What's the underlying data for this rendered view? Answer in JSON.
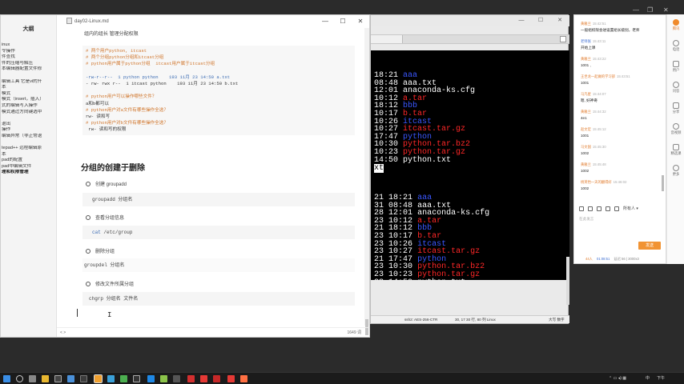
{
  "editor": {
    "title": "day02-Linux.md",
    "outline_title": "大纲",
    "outline_items": [
      "inux",
      "令操作",
      "件查找",
      "件的压缩与解压",
      "本编辑器配置文件修",
      "",
      "编辑工具 它是vi的升",
      "本",
      "模式",
      "模式（insert，插入）",
      "式的编辑写入操作",
      "模式通过方向键选中",
      "",
      "退出",
      "操作",
      "编辑异常（非正常退",
      "",
      "tepad++ 远程编辑原",
      "本",
      "pad的配置",
      "pad中编辑文件",
      "理和权限管理"
    ],
    "top_text": "组内的组长    管理分配权限",
    "code_block_1": [
      {
        "cls": "cm",
        "text": "# 两个用户python, itcast"
      },
      {
        "cls": "cm",
        "text": "# 两个分组python分组和itcast分组"
      },
      {
        "cls": "cm",
        "text": "# python用户属于python分组  itcast用户属于itcast分组"
      },
      {
        "cls": "tx",
        "text": ""
      },
      {
        "cls": "pl",
        "text": "-rw-r--r--  1 python python    193 11月 23 14:50 a.txt"
      },
      {
        "cls": "tx",
        "text": "- rw- rwx r--  1 itcast python    193 11月 23 14:50 b.txt"
      },
      {
        "cls": "tx",
        "text": ""
      },
      {
        "cls": "cm",
        "text": "# python用户可以操作哪些文件？"
      },
      {
        "cls": "tx",
        "text": "a和b都可以"
      },
      {
        "cls": "cm",
        "text": "# python用户对a文件有哪些操作全选？"
      },
      {
        "cls": "tx",
        "text": "rw- 读和写"
      },
      {
        "cls": "cm",
        "text": "# python用户对b文件有哪些操作全选？"
      },
      {
        "cls": "tx",
        "text": " rw- 读和写的权限"
      }
    ],
    "heading": "分组的创建于删除",
    "bullet_create": "创建 groupadd",
    "code_create": "groupadd 分组名",
    "bullet_view": "查看分组信息",
    "code_view_kw": "cat",
    "code_view_rest": " /etc/group",
    "bullet_delete": "删除分组",
    "code_delete": "groupdel 分组名",
    "bullet_modify": "修改文件所属分组",
    "code_modify": "chgrp 分组名 文件名",
    "status_left": "<  >",
    "word_count": "1649 词"
  },
  "terminal": {
    "upper": [
      {
        "time": "18:21",
        "name": "aaa",
        "color": "b"
      },
      {
        "time": "08:48",
        "name": "aaa.txt",
        "color": "w"
      },
      {
        "time": "12:01",
        "name": "anaconda-ks.cfg",
        "color": "w"
      },
      {
        "time": "10:12",
        "name": "a.tar",
        "color": "r"
      },
      {
        "time": "18:12",
        "name": "bbb",
        "color": "b"
      },
      {
        "time": "10:17",
        "name": "b.tar",
        "color": "r"
      },
      {
        "time": "10:26",
        "name": "itcast",
        "color": "b"
      },
      {
        "time": "10:27",
        "name": "itcast.tar.gz",
        "color": "r"
      },
      {
        "time": "17:47",
        "name": "python",
        "color": "b"
      },
      {
        "time": "10:30",
        "name": "python.tar.bz2",
        "color": "r"
      },
      {
        "time": "10:23",
        "name": "python.tar.gz",
        "color": "r"
      },
      {
        "time": "14:50",
        "name": "python.txt",
        "color": "w"
      }
    ],
    "mid_fragment": "xt",
    "lower": [
      {
        "day": "21",
        "time": "18:21",
        "name": "aaa",
        "color": "b"
      },
      {
        "day": "31",
        "time": "08:48",
        "name": "aaa.txt",
        "color": "w"
      },
      {
        "day": "28",
        "time": "12:01",
        "name": "anaconda-ks.cfg",
        "color": "w"
      },
      {
        "day": "23",
        "time": "10:12",
        "name": "a.tar",
        "color": "r"
      },
      {
        "day": "21",
        "time": "18:12",
        "name": "bbb",
        "color": "b"
      },
      {
        "day": "23",
        "time": "10:17",
        "name": "b.tar",
        "color": "r"
      },
      {
        "day": "23",
        "time": "10:26",
        "name": "itcast",
        "color": "b"
      },
      {
        "day": "23",
        "time": "10:27",
        "name": "itcast.tar.gz",
        "color": "r"
      },
      {
        "day": "21",
        "time": "17:47",
        "name": "python",
        "color": "b"
      },
      {
        "day": "23",
        "time": "10:30",
        "name": "python.tar.bz2",
        "color": "r"
      },
      {
        "day": "23",
        "time": "10:23",
        "name": "python.tar.gz",
        "color": "r"
      },
      {
        "day": "23",
        "time": "14:50",
        "name": "python.txt",
        "color": "w"
      }
    ],
    "status_ssh": "ssh2: AES-256-CTR",
    "status_pos": "30, 17  30 行, 80 列  Linux",
    "status_right": "大写  数字"
  },
  "chat": {
    "messages": [
      {
        "who": "黄雅兰",
        "time": "15:42:51",
        "text": "一般组权限会进设置组长级别，老师",
        "teacher": false
      },
      {
        "who": "老师张",
        "time": "15:43:11",
        "text": "开始上课",
        "teacher": true
      },
      {
        "who": "黄雅兰",
        "time": "15:43:22",
        "text": "1001 ,",
        "teacher": false
      },
      {
        "who": "王世龙一起做的学习部",
        "time": "15:43:51",
        "text": "1001",
        "teacher": false
      },
      {
        "who": "马凡星",
        "time": "15:44:07",
        "text": "嗯, 好神奇",
        "teacher": false
      },
      {
        "who": "黄雅兰",
        "time": "15:44:32",
        "text": "4e1",
        "teacher": false
      },
      {
        "who": "赵文宏",
        "time": "15:45:12",
        "text": "1001",
        "teacher": false
      },
      {
        "who": "马文国",
        "time": "15:45:30",
        "text": "1002",
        "teacher": false
      },
      {
        "who": "黄雅兰",
        "time": "15:45:48",
        "text": "1002",
        "teacher": false
      },
      {
        "who": "杨英怡一天的翻得好",
        "time": "15:46:02",
        "text": "1002",
        "teacher": false
      }
    ],
    "tools_label": "所有人",
    "input_placeholder": "在此发言",
    "send_label": "发送",
    "status_count": "44人",
    "status_timer": "01:08:51",
    "status_net": "延迟 56 | 3000x3"
  },
  "rail": [
    "腾讯",
    "电话",
    "用户",
    "问答",
    "分享",
    "音视频",
    "精选课",
    "更多"
  ],
  "taskbar": {
    "tray_lang": "中",
    "tray_time": "下午"
  }
}
